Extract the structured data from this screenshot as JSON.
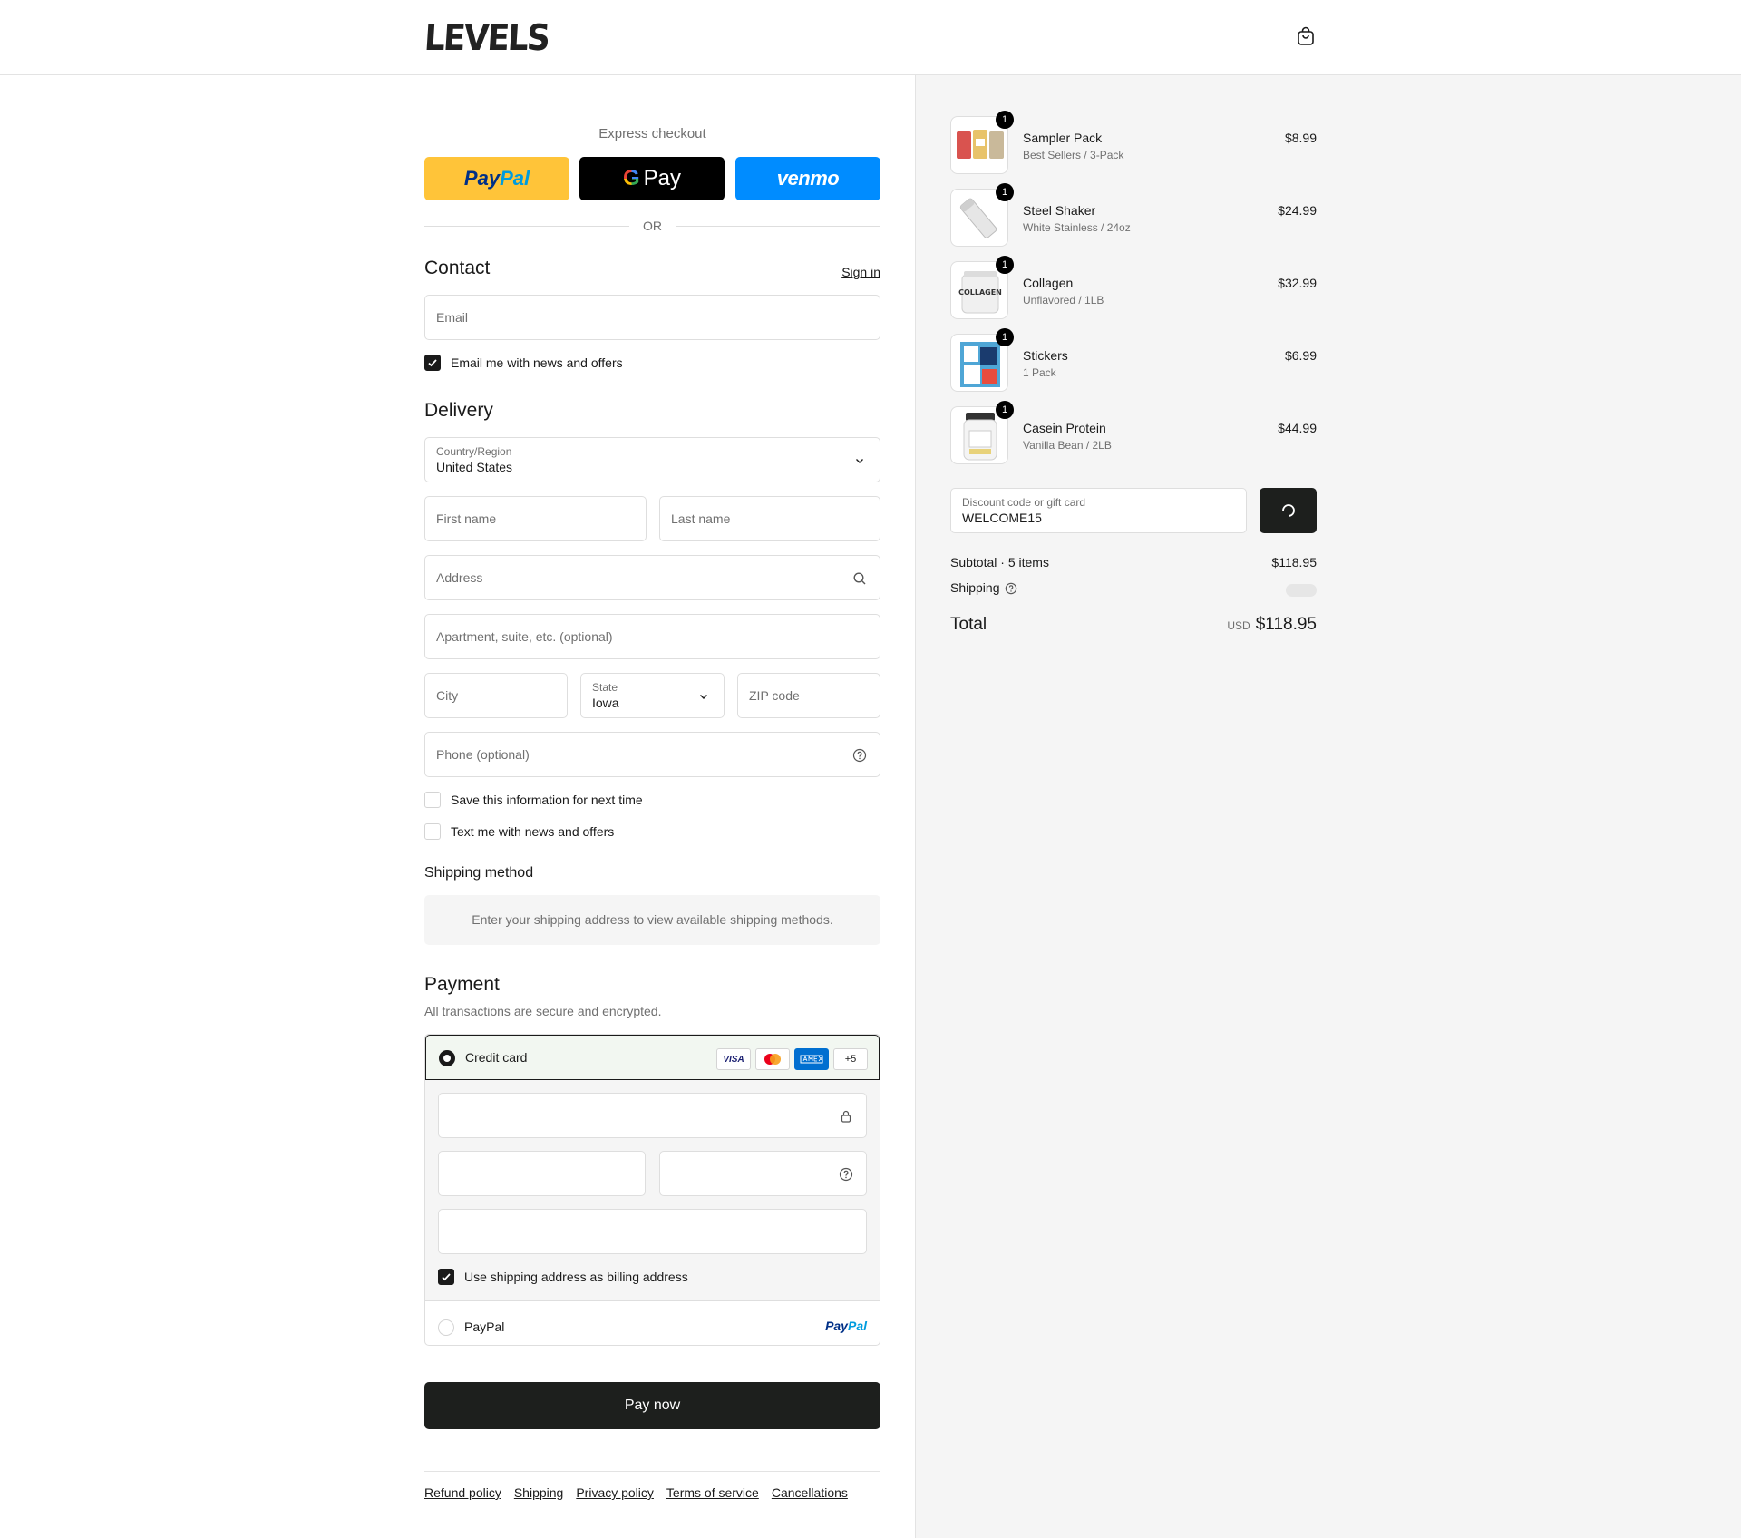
{
  "header": {
    "logo": "LEVELS"
  },
  "express": {
    "label": "Express checkout",
    "paypal_a": "Pay",
    "paypal_b": "Pal",
    "gpay_g": "G",
    "gpay_text": "Pay",
    "venmo": "venmo",
    "or": "OR"
  },
  "contact": {
    "title": "Contact",
    "sign_in": "Sign in",
    "email_placeholder": "Email",
    "news_label": "Email me with news and offers"
  },
  "delivery": {
    "title": "Delivery",
    "country_label": "Country/Region",
    "country_value": "United States",
    "first_name": "First name",
    "last_name": "Last name",
    "address": "Address",
    "apartment": "Apartment, suite, etc. (optional)",
    "city": "City",
    "state_label": "State",
    "state_value": "Iowa",
    "zip": "ZIP code",
    "phone": "Phone (optional)",
    "save_info": "Save this information for next time",
    "text_offers": "Text me with news and offers"
  },
  "shipping_method": {
    "title": "Shipping method",
    "notice": "Enter your shipping address to view available shipping methods."
  },
  "payment": {
    "title": "Payment",
    "subtitle": "All transactions are secure and encrypted.",
    "credit_card": "Credit card",
    "card_visa": "VISA",
    "card_more": "+5",
    "billing_same": "Use shipping address as billing address",
    "paypal": "PayPal",
    "paypal_logo_a": "Pay",
    "paypal_logo_b": "Pal"
  },
  "pay_now": "Pay now",
  "footer": [
    "Refund policy",
    "Shipping",
    "Privacy policy",
    "Terms of service",
    "Cancellations"
  ],
  "cart": {
    "items": [
      {
        "qty": "1",
        "name": "Sampler Pack",
        "variant": "Best Sellers / 3-Pack",
        "price": "$8.99"
      },
      {
        "qty": "1",
        "name": "Steel Shaker",
        "variant": "White Stainless / 24oz",
        "price": "$24.99"
      },
      {
        "qty": "1",
        "name": "Collagen",
        "variant": "Unflavored / 1LB",
        "price": "$32.99",
        "thumb_text": "COLLAGEN"
      },
      {
        "qty": "1",
        "name": "Stickers",
        "variant": "1 Pack",
        "price": "$6.99"
      },
      {
        "qty": "1",
        "name": "Casein Protein",
        "variant": "Vanilla Bean / 2LB",
        "price": "$44.99"
      }
    ],
    "discount_label": "Discount code or gift card",
    "discount_value": "WELCOME15",
    "subtotal_label": "Subtotal · 5 items",
    "subtotal_value": "$118.95",
    "shipping_label": "Shipping",
    "total_label": "Total",
    "currency": "USD",
    "total_value": "$118.95"
  },
  "colors": {
    "paypal_yellow": "#ffc439",
    "venmo_blue": "#008cff",
    "primary_dark": "#1d1f1d",
    "sidebar_bg": "#f5f5f5"
  }
}
